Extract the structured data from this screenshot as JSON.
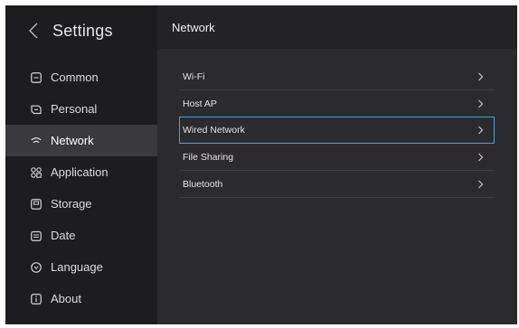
{
  "sidebar": {
    "title": "Settings",
    "back_icon": "chevron-left-icon",
    "items": [
      {
        "label": "Common",
        "icon": "square-icon"
      },
      {
        "label": "Personal",
        "icon": "personal-icon"
      },
      {
        "label": "Network",
        "icon": "wifi-icon",
        "active": true
      },
      {
        "label": "Application",
        "icon": "grid-icon"
      },
      {
        "label": "Storage",
        "icon": "storage-icon"
      },
      {
        "label": "Date",
        "icon": "calendar-icon"
      },
      {
        "label": "Language",
        "icon": "globe-icon"
      },
      {
        "label": "About",
        "icon": "info-icon"
      }
    ]
  },
  "content": {
    "title": "Network",
    "rows": [
      {
        "label": "Wi-Fi"
      },
      {
        "label": "Host AP"
      },
      {
        "label": "Wired Network",
        "selected": true
      },
      {
        "label": "File Sharing"
      },
      {
        "label": "Bluetooth"
      }
    ]
  },
  "colors": {
    "background": "#2b2b2e",
    "sidebar": "#1d1d20",
    "active_item": "#3a3a3e",
    "selection_border": "#3aa5e8"
  }
}
